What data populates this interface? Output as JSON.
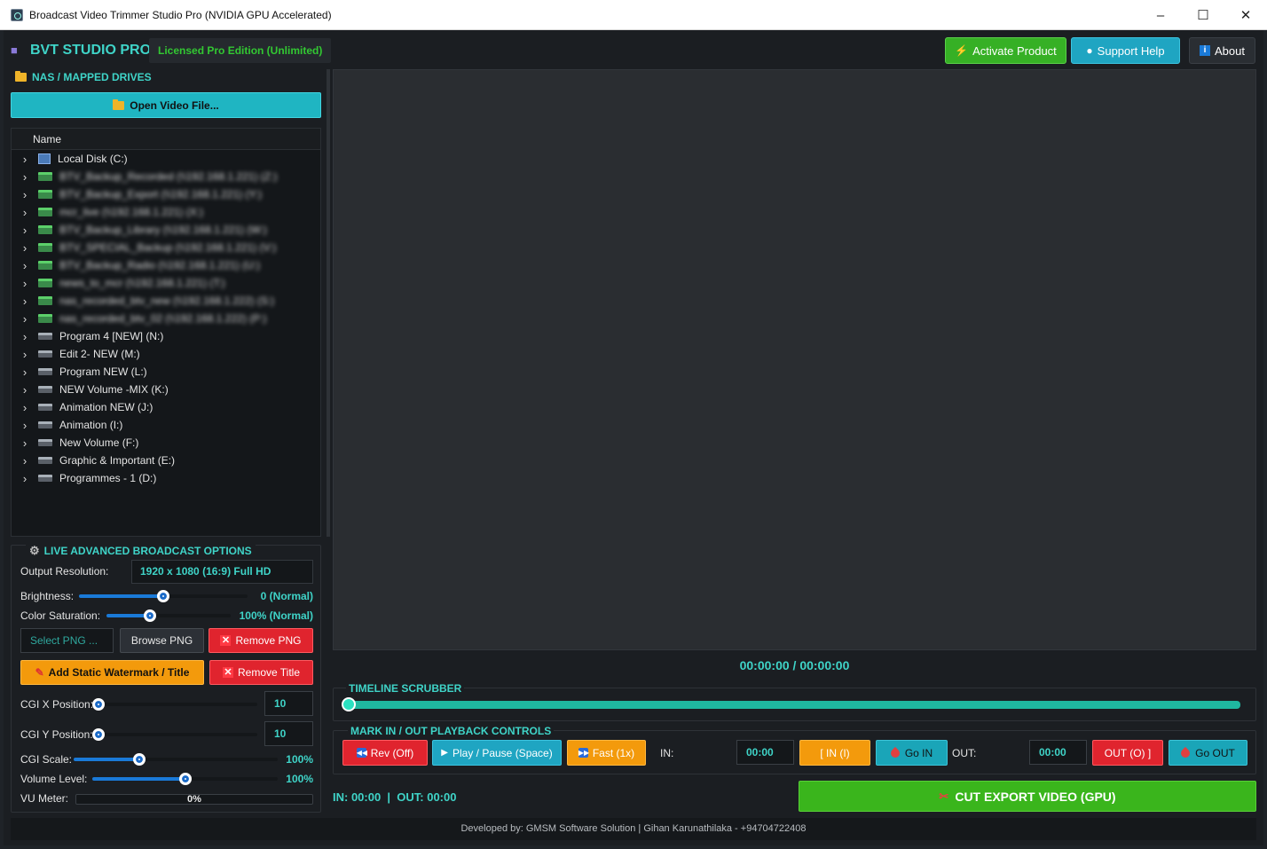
{
  "window": {
    "title": "Broadcast Video Trimmer Studio Pro (NVIDIA GPU Accelerated)",
    "minimize": "–",
    "maximize": "☐",
    "close": "✕"
  },
  "header": {
    "brand": "BVT STUDIO PRO",
    "license": "Licensed Pro Edition (Unlimited)",
    "activate_label": "Activate Product",
    "support_label": "Support  Help",
    "about_label": "About"
  },
  "browser": {
    "section_title": "NAS / MAPPED DRIVES",
    "open_label": "Open Video File...",
    "column_name": "Name",
    "drives": [
      {
        "label": "Local Disk (C:)",
        "type": "sys",
        "blurred": false
      },
      {
        "label": "BTV_Backup_Recorded (\\\\192.168.1.221) (Z:)",
        "type": "net",
        "blurred": true
      },
      {
        "label": "BTV_Backup_Export (\\\\192.168.1.221) (Y:)",
        "type": "net",
        "blurred": true
      },
      {
        "label": "mcr_live (\\\\192.168.1.221) (X:)",
        "type": "net",
        "blurred": true
      },
      {
        "label": "BTV_Backup_Library (\\\\192.168.1.221) (W:)",
        "type": "net",
        "blurred": true
      },
      {
        "label": "BTV_SPECIAL_Backup (\\\\192.168.1.221) (V:)",
        "type": "net",
        "blurred": true
      },
      {
        "label": "BTV_Backup_Radio (\\\\192.168.1.221) (U:)",
        "type": "net",
        "blurred": true
      },
      {
        "label": "news_to_mcr (\\\\192.168.1.221) (T:)",
        "type": "net",
        "blurred": true
      },
      {
        "label": "nas_recorded_btv_new (\\\\192.168.1.222) (S:)",
        "type": "net",
        "blurred": true
      },
      {
        "label": "nas_recorded_btv_02 (\\\\192.168.1.222) (P:)",
        "type": "net",
        "blurred": true
      },
      {
        "label": "Program 4 [NEW] (N:)",
        "type": "local",
        "blurred": false
      },
      {
        "label": "Edit 2- NEW (M:)",
        "type": "local",
        "blurred": false
      },
      {
        "label": "Program NEW (L:)",
        "type": "local",
        "blurred": false
      },
      {
        "label": "NEW Volume -MIX (K:)",
        "type": "local",
        "blurred": false
      },
      {
        "label": "Animation NEW (J:)",
        "type": "local",
        "blurred": false
      },
      {
        "label": "Animation (I:)",
        "type": "local",
        "blurred": false
      },
      {
        "label": "New Volume (F:)",
        "type": "local",
        "blurred": false
      },
      {
        "label": "Graphic & Important (E:)",
        "type": "local",
        "blurred": false
      },
      {
        "label": "Programmes - 1 (D:)",
        "type": "local",
        "blurred": false
      }
    ]
  },
  "options": {
    "section_title": "LIVE ADVANCED BROADCAST OPTIONS",
    "output_resolution_label": "Output Resolution:",
    "output_resolution_value": "1920 x 1080 (16:9) Full HD",
    "brightness_label": "Brightness:",
    "brightness_value": "0 (Normal)",
    "brightness_level": 0.5,
    "saturation_label": "Color Saturation:",
    "saturation_value": "100% (Normal)",
    "saturation_level": 0.35,
    "select_png_placeholder": "Select PNG ...",
    "browse_png_label": "Browse PNG",
    "remove_png_label": "Remove PNG",
    "add_watermark_label": "Add Static Watermark / Title",
    "remove_title_label": "Remove Title",
    "cgi_x_label": "CGI X Position:",
    "cgi_x_value": "10",
    "cgi_y_label": "CGI Y Position:",
    "cgi_y_value": "10",
    "cgi_scale_label": "CGI Scale:",
    "cgi_scale_value": "100%",
    "cgi_scale_level": 0.32,
    "volume_label": "Volume Level:",
    "volume_value": "100%",
    "volume_level": 0.5,
    "vu_label": "VU Meter:",
    "vu_value": "0%"
  },
  "player": {
    "timecode": "00:00:00 / 00:00:00",
    "timeline_title": "TIMELINE SCRUBBER",
    "playback_title": "MARK IN / OUT  PLAYBACK CONTROLS",
    "rev_label": "Rev (Off)",
    "play_label": "Play / Pause (Space)",
    "fast_label": "Fast (1x)",
    "in_label": "IN:",
    "in_value": "00:00",
    "mark_in_label": "[ IN (I)",
    "go_in_label": "Go IN",
    "out_label": "OUT:",
    "out_value": "00:00",
    "mark_out_label": "OUT (O) ]",
    "go_out_label": "Go OUT",
    "inout_summary": "IN: 00:00  |  OUT: 00:00",
    "export_label": "CUT  EXPORT VIDEO (GPU)"
  },
  "footer": {
    "credits": "Developed by: GMSM Software Solution | Gihan Karunathilaka - +94704722408"
  }
}
